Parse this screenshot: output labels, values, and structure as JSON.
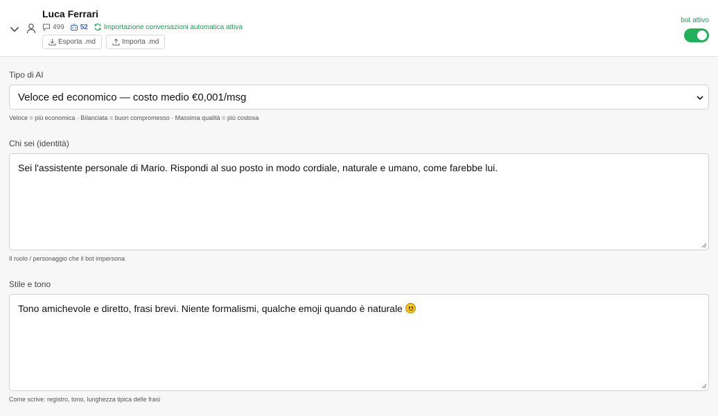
{
  "contact": {
    "name": "Luca Ferrari",
    "message_count": "499",
    "bot_message_count": "52",
    "import_status": "Importazione conversazioni automatica attiva"
  },
  "actions": {
    "export_label": "Esporta .md",
    "import_label": "Importa .md"
  },
  "bot_toggle": {
    "label": "bot attivo",
    "enabled": true,
    "on_color": "#22b05a"
  },
  "ai_type": {
    "label": "Tipo di AI",
    "selected": "Veloce ed economico — costo medio €0,001/msg",
    "hint": "Veloce = più economica · Bilanciata = buon compromesso · Massima qualità = più costosa"
  },
  "identity": {
    "label": "Chi sei (identità)",
    "value": "Sei l'assistente personale di Mario. Rispondi al suo posto in modo cordiale, naturale e umano, come farebbe lui.",
    "hint": "Il ruolo / personaggio che il bot impersona"
  },
  "style": {
    "label": "Stile e tono",
    "value": "Tono amichevole e diretto, frasi brevi. Niente formalismi, qualche emoji quando è naturale",
    "emoji": "slightly-smiling-face-icon",
    "hint": "Come scrive: registro, tono, lunghezza tipica delle frasi"
  },
  "colors": {
    "accent_green": "#1a9a55",
    "accent_blue": "#2e63d6"
  }
}
